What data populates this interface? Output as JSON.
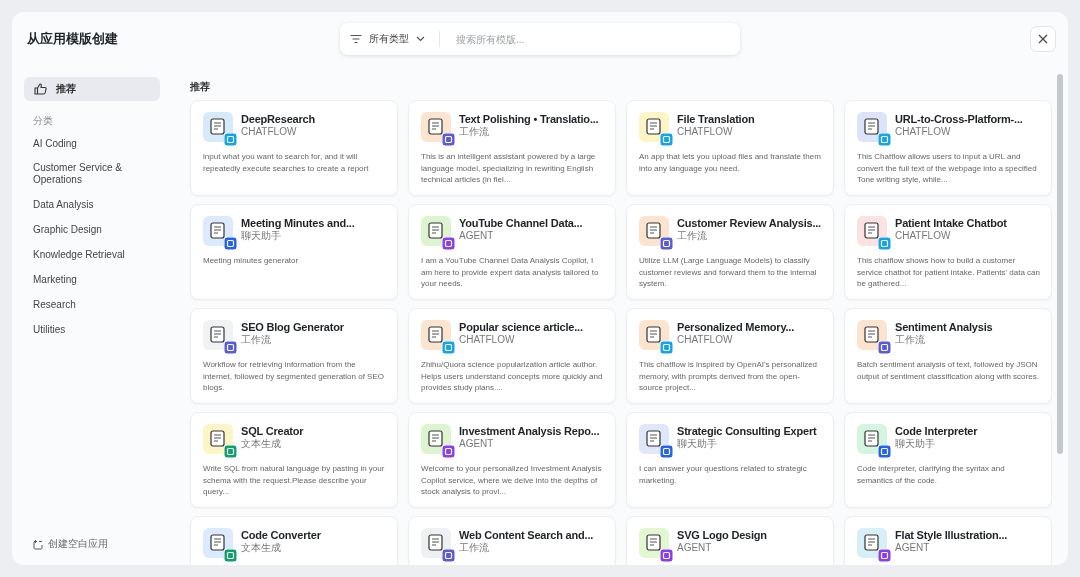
{
  "title": "从应用模版创建",
  "search": {
    "filter": "所有类型",
    "placeholder": "搜索所有模版..."
  },
  "sidebar": {
    "items": [
      {
        "label": "推荐",
        "selected": true
      }
    ],
    "section": "分类",
    "categories": [
      {
        "label": "AI Coding",
        "selected": false
      },
      {
        "label": "Customer Service & Operations",
        "selected": false
      },
      {
        "label": "Data Analysis",
        "selected": false
      },
      {
        "label": "Graphic Design",
        "selected": false
      },
      {
        "label": "Knowledge Retrieval",
        "selected": false
      },
      {
        "label": "Marketing",
        "selected": false
      },
      {
        "label": "Research",
        "selected": false
      },
      {
        "label": "Utilities",
        "selected": false
      }
    ],
    "create_blank": "创建空白应用"
  },
  "section_title": "推荐",
  "templates": [
    {
      "name": "DeepResearch",
      "kind": "chatflow",
      "type": "CHATFLOW",
      "color": "#d6eafb",
      "description": "input what you want to search for, and it will repeatedly execute searches to create a report"
    },
    {
      "name": "Text Polishing • Translatio...",
      "kind": "workflow",
      "type": "工作流",
      "color": "#fde4cf",
      "description": "This is an intelligent assistant powered by a large language model, specializing in rewriting English technical articles (in fiel..."
    },
    {
      "name": "File Translation",
      "kind": "chatflow",
      "type": "CHATFLOW",
      "color": "#fef5c7",
      "description": "An app that lets you upload files and translate them into any language you need."
    },
    {
      "name": "URL-to-Cross-Platform-...",
      "kind": "chatflow",
      "type": "CHATFLOW",
      "color": "#dbe4fb",
      "description": "This Chatflow allows users to input a URL and convert the full text of the webpage into a specified Tone writing style, while..."
    },
    {
      "name": "Meeting Minutes and...",
      "kind": "chat",
      "type": "聊天助手",
      "color": "#dbeafe",
      "description": "Meeting minutes generator"
    },
    {
      "name": "YouTube Channel Data...",
      "kind": "agent",
      "type": "AGENT",
      "color": "#dcf5d0",
      "description": "I am a YouTube Channel Data Analysis Copilot, I am here to provide expert data analysis tailored to your needs."
    },
    {
      "name": "Customer Review Analysis...",
      "kind": "workflow",
      "type": "工作流",
      "color": "#fde4cf",
      "description": "Utilize LLM (Large Language Models) to classify customer reviews and forward them to the internal system."
    },
    {
      "name": "Patient Intake Chatbot",
      "kind": "chatflow",
      "type": "CHATFLOW",
      "color": "#fde2e4",
      "description": "This chatflow shows how to build a customer service chatbot for patient intake. Patients' data can be gathered..."
    },
    {
      "name": "SEO Blog Generator",
      "kind": "workflow",
      "type": "工作流",
      "color": "#f1f2f4",
      "description": "Workflow for retrieving information from the internet, followed by segmented generation of SEO blogs."
    },
    {
      "name": "Popular science article...",
      "kind": "chatflow",
      "type": "CHATFLOW",
      "color": "#fde4cf",
      "description": "Zhihu/Quora science popularization article author. Helps users understand concepts more quickly and provides study plans...."
    },
    {
      "name": "Personalized Memory...",
      "kind": "chatflow",
      "type": "CHATFLOW",
      "color": "#fde4cf",
      "description": "This chatflow is inspired by OpenAI's personalized memory, with prompts derived from the open-source project..."
    },
    {
      "name": "Sentiment Analysis",
      "kind": "workflow",
      "type": "工作流",
      "color": "#fde4cf",
      "description": "Batch sentiment analysis of text, followed by JSON output of sentiment classification along with scores."
    },
    {
      "name": "SQL Creator",
      "kind": "text",
      "type": "文本生成",
      "color": "#fef5c7",
      "description": "Write SQL from natural language by pasting in your schema with the request.Please describe your query..."
    },
    {
      "name": "Investment Analysis Repo...",
      "kind": "agent",
      "type": "AGENT",
      "color": "#dcf5d0",
      "description": "Welcome to your personalized Investment Analysis Copilot service, where we delve into the depths of stock analysis to provi..."
    },
    {
      "name": "Strategic Consulting Expert",
      "kind": "chat",
      "type": "聊天助手",
      "color": "#e0e7fb",
      "description": "I can answer your questions related to strategic marketing."
    },
    {
      "name": "Code Interpreter",
      "kind": "chat",
      "type": "聊天助手",
      "color": "#d6f5e0",
      "description": "Code interpreter, clarifying the syntax and semantics of the code."
    },
    {
      "name": "Code Converter",
      "kind": "text",
      "type": "文本生成",
      "color": "#dbeafe"
    },
    {
      "name": "Web Content Search and...",
      "kind": "workflow",
      "type": "工作流",
      "color": "#eef0f4"
    },
    {
      "name": "SVG Logo Design",
      "kind": "agent",
      "type": "AGENT",
      "color": "#e3f7d0"
    },
    {
      "name": "Flat Style Illustration...",
      "kind": "agent",
      "type": "AGENT",
      "color": "#d6f0f5"
    }
  ]
}
